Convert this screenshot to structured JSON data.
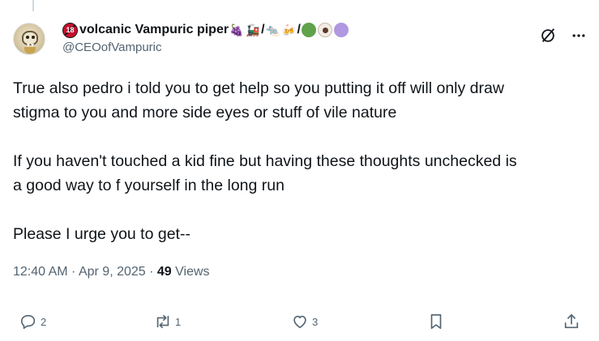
{
  "post": {
    "author": {
      "display_name_prefix_badge": "18",
      "display_name": "volcanic Vampuric piper",
      "name_emojis": [
        "🍇",
        "🚂",
        "/",
        "🐀",
        "🍻",
        "/"
      ],
      "name_dots_colors": [
        "#5fa24a",
        "eye",
        "#b198e0"
      ],
      "handle": "@CEOofVampuric"
    },
    "text": {
      "line1": "True also pedro i told you to get help so you putting it off will only draw",
      "line2": "stigma to you and more side eyes or stuff of vile nature",
      "line3": "If you haven't touched a kid fine but having these thoughts unchecked is",
      "line4": "a good way to f yourself in the long run",
      "line5": "Please I urge you to get--"
    },
    "meta": {
      "time": "12:40 AM",
      "sep1": " · ",
      "date": "Apr 9, 2025",
      "sep2": " · ",
      "views_count": "49",
      "views_label": " Views"
    },
    "actions": {
      "reply_count": "2",
      "repost_count": "1",
      "like_count": "3"
    }
  },
  "icons": {
    "reply": "reply-icon",
    "repost": "repost-icon",
    "like": "heart-icon",
    "bookmark": "bookmark-icon",
    "share": "share-icon",
    "grok": "grok-icon",
    "more": "more-icon"
  },
  "colors": {
    "text_primary": "#0f1419",
    "text_secondary": "#536471",
    "badge_red": "#c8102e"
  }
}
